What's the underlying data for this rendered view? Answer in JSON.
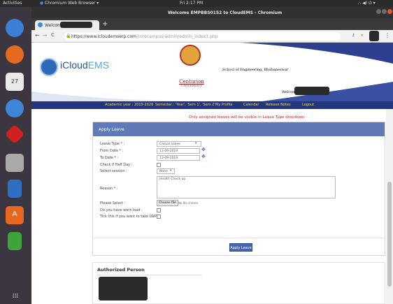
{
  "topbar": {
    "activities": "Activities",
    "app": "Chromium Web Browser ▾",
    "clock": "Fri 2:17 PM",
    "status_icons": "⛬ ◀) ⏻ ▾"
  },
  "dock": {
    "icons": [
      "chromium-icon",
      "firefox-icon",
      "calendar-icon",
      "chromium-icon",
      "ruby-icon",
      "files-icon",
      "writer-icon",
      "software-icon",
      "calc-icon",
      "apps-grid-icon"
    ]
  },
  "browser": {
    "window_title": "Welcome EMPBBS0152 to CloudEMS - Chromium",
    "tab_label": "Welcom",
    "url_prefix": "https://www.icloudemserp.com",
    "url_suffix": "/corecampus/admin/admin_index1.php",
    "new_tab": "+",
    "back": "←",
    "forward": "→",
    "reload": "C"
  },
  "page": {
    "logo_i": "i",
    "logo_cloud": "Cloud",
    "logo_ems": "EMS",
    "university_line1": "Centurion",
    "university_line2": "UNIVERSITY",
    "school": "School of Engineering, Bhubaneswar",
    "welcome": "Welcome",
    "nav": {
      "academic_year": "Academic year : 2019-2020",
      "semester": "Semester : 'Year', 'Sem 1', 'Sem 2'",
      "my_profile": "My Profile",
      "calendar": "Calendar",
      "release_notes": "Release Notes",
      "logout": "Logout"
    },
    "notice": "Only assigned leaves will be visible in Leave Type dropdown"
  },
  "form": {
    "title": "Apply Leave",
    "labels": {
      "leave_type": "Leave Type * :",
      "from_date": "From Date * :",
      "to_date": "To Date * :",
      "half_day": "Check if Half Day :",
      "select_session": "Select session :",
      "reason": "Reason * :",
      "please_select": "Please Select :",
      "work_load": "Do you have work load :",
      "lwp": "Tick this if you want to take LWP :"
    },
    "values": {
      "leave_type": "Casual Leave",
      "from_date": "13-09-2019",
      "to_date": "13-09-2019",
      "session": "None",
      "reason": "Health Check up",
      "file_button": "Choose file",
      "file_status": "No file chosen"
    },
    "apply_button": "Apply Leave"
  },
  "authorized": {
    "title": "Authorized Person"
  }
}
